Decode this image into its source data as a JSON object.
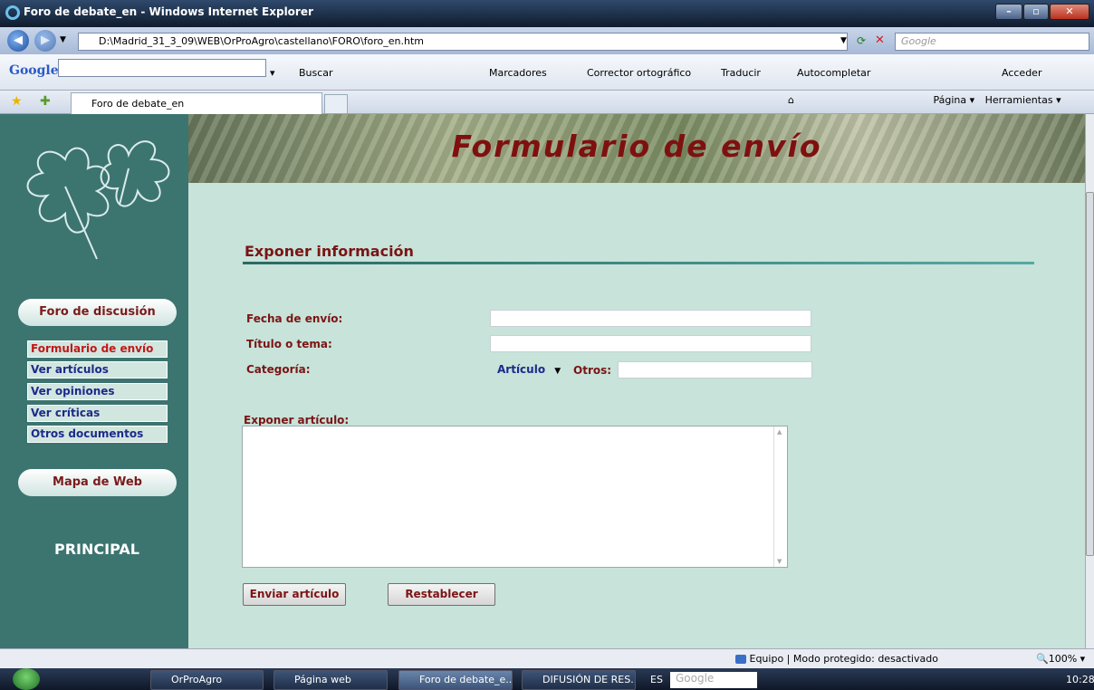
{
  "window": {
    "title": "Foro de debate_en - Windows Internet Explorer"
  },
  "address": {
    "url": "D:\\Madrid_31_3_09\\WEB\\OrProAgro\\castellano\\FORO\\foro_en.htm",
    "search_placeholder": "Google"
  },
  "google_toolbar": {
    "logo": "Google",
    "buscar": "Buscar",
    "marcadores": "Marcadores",
    "corrector": "Corrector ortográfico",
    "traducir": "Traducir",
    "autocompletar": "Autocompletar",
    "acceder": "Acceder"
  },
  "tab": {
    "label": "Foro de debate_en"
  },
  "command_bar": {
    "pagina": "Página",
    "herramientas": "Herramientas"
  },
  "banner": {
    "title": "Formulario de envío"
  },
  "sidebar": {
    "foro_label": "Foro de discusión",
    "items": [
      {
        "label": "Formulario de envío",
        "active": true
      },
      {
        "label": "Ver artículos"
      },
      {
        "label": "Ver opiniones"
      },
      {
        "label": "Ver críticas"
      },
      {
        "label": "Otros documentos"
      }
    ],
    "mapa_label": "Mapa de Web",
    "principal": "PRINCIPAL"
  },
  "form": {
    "heading": "Exponer información",
    "fecha_label": "Fecha de envío:",
    "fecha_value": "",
    "titulo_label": "Título o tema:",
    "titulo_value": "",
    "categoria_label": "Categoría:",
    "categoria_selected": "Artículo",
    "otros_label": "Otros:",
    "otros_value": "",
    "articulo_label": "Exponer artículo:",
    "articulo_value": "",
    "submit_label": "Enviar artículo",
    "reset_label": "Restablecer"
  },
  "statusbar": {
    "zone": "Equipo | Modo protegido: desactivado",
    "zoom": "100%"
  },
  "taskbar": {
    "items": [
      "OrProAgro",
      "Página web",
      "Foro de debate_e...",
      "DIFUSIÓN DE RES..."
    ],
    "lang": "ES",
    "search": "Google",
    "clock": "10:28"
  },
  "colors": {
    "accent": "#7b1414",
    "sidebar": "#3c7470",
    "page_bg": "#c7e3da",
    "menu_text": "#1d2a8a"
  }
}
